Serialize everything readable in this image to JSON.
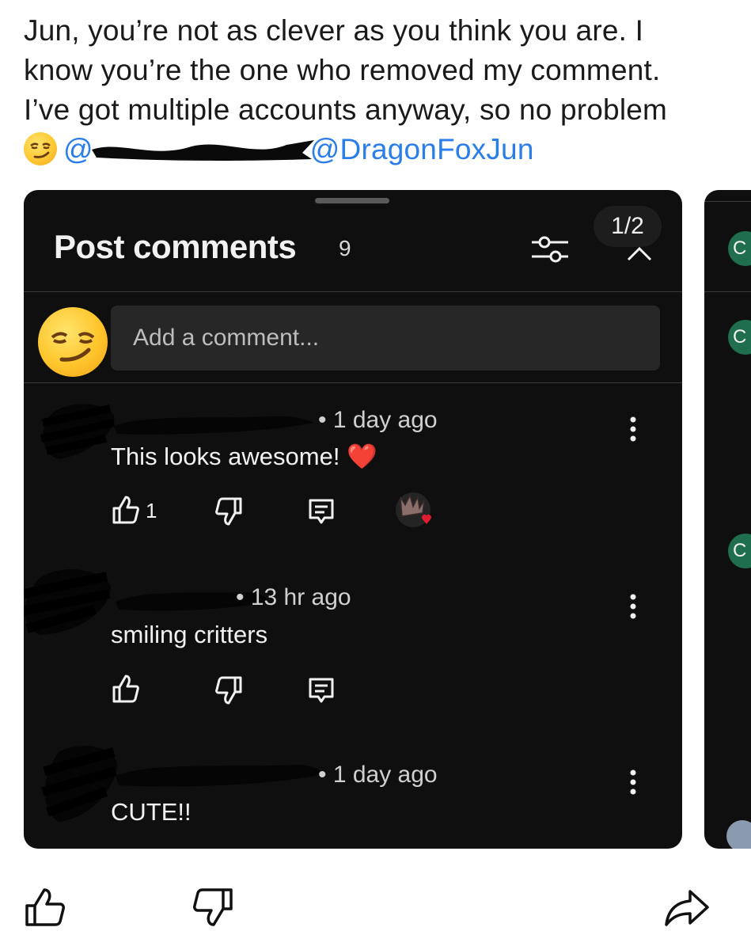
{
  "post": {
    "line1": "Jun, you’re not as clever as you think you are. I",
    "line2": "know you’re the one who removed my comment.",
    "line3": "I’ve got multiple accounts anyway, so no problem",
    "mention_prefix": "@",
    "mention_handle": "@DragonFoxJun",
    "emoji_icon": "smirking-face-icon"
  },
  "panel": {
    "title": "Post comments",
    "count": "9",
    "page_indicator": "1/2",
    "input_placeholder": "Add a comment..."
  },
  "comments": [
    {
      "time": "• 1 day ago",
      "text": "This looks awesome!",
      "emoji": "❤️",
      "likes": "1"
    },
    {
      "time": "• 13 hr ago",
      "text": "smiling critters",
      "likes": ""
    },
    {
      "time": "• 1 day ago",
      "text": "CUTE!!",
      "likes": ""
    }
  ],
  "peek": {
    "button_letter": "C"
  },
  "colors": {
    "panel_bg": "#0f0f0f",
    "input_bg": "#272727",
    "link": "#2b7de9",
    "heart": "#ea2c3b"
  }
}
